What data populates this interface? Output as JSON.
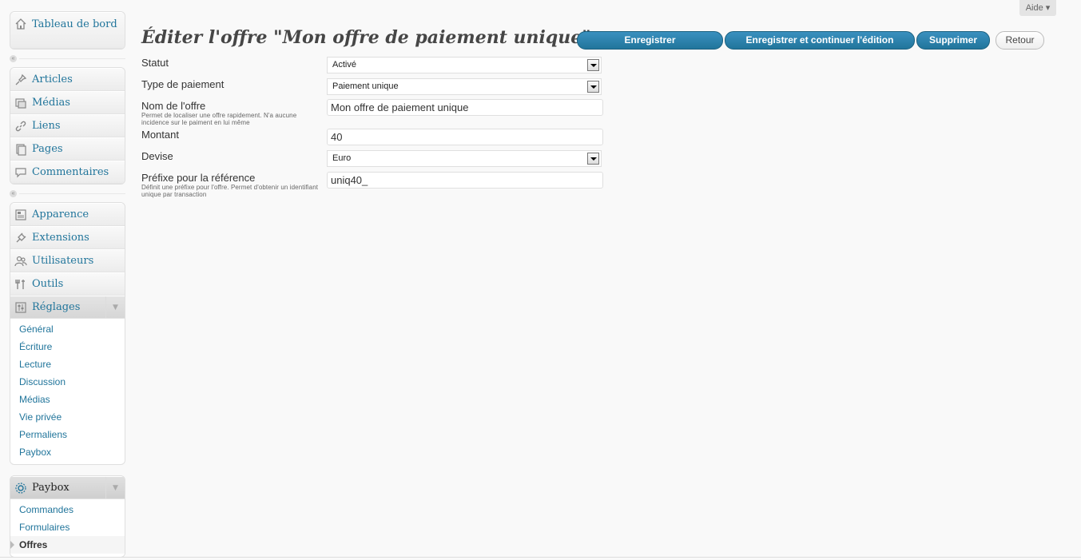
{
  "help": {
    "label": "Aide ▾"
  },
  "sidebar": {
    "dashboard": {
      "label": "Tableau de bord"
    },
    "group1": [
      {
        "label": "Articles",
        "icon": "pin-icon"
      },
      {
        "label": "Médias",
        "icon": "media-icon"
      },
      {
        "label": "Liens",
        "icon": "link-icon"
      },
      {
        "label": "Pages",
        "icon": "pages-icon"
      },
      {
        "label": "Commentaires",
        "icon": "comments-icon"
      }
    ],
    "group2": [
      {
        "label": "Apparence",
        "icon": "appearance-icon"
      },
      {
        "label": "Extensions",
        "icon": "plugin-icon"
      },
      {
        "label": "Utilisateurs",
        "icon": "users-icon"
      },
      {
        "label": "Outils",
        "icon": "tools-icon"
      }
    ],
    "settings": {
      "label": "Réglages",
      "items": [
        "Général",
        "Écriture",
        "Lecture",
        "Discussion",
        "Médias",
        "Vie privée",
        "Permaliens",
        "Paybox"
      ]
    },
    "paybox": {
      "label": "Paybox",
      "items": [
        "Commandes",
        "Formulaires",
        "Offres"
      ],
      "current": "Offres"
    }
  },
  "main": {
    "title": "Éditer l'offre \"Mon offre de paiement unique\"",
    "buttons": {
      "save": "Enregistrer",
      "save_continue": "Enregistrer et continuer l'édition",
      "delete": "Supprimer",
      "back": "Retour"
    },
    "form": {
      "statut": {
        "label": "Statut",
        "value": "Activé"
      },
      "type": {
        "label": "Type de paiement",
        "value": "Paiement unique"
      },
      "nom": {
        "label": "Nom de l'offre",
        "help": "Permet de localiser une offre rapidement. N'a aucune incidence sur le paiment en lui même",
        "value": "Mon offre de paiement unique"
      },
      "montant": {
        "label": "Montant",
        "value": "40"
      },
      "devise": {
        "label": "Devise",
        "value": "Euro"
      },
      "prefixe": {
        "label": "Préfixe pour la référence",
        "help": "Définit une préfixe pour l'offre. Permet d'obtenir un identifiant unique par transaction",
        "value": "uniq40_"
      }
    }
  }
}
